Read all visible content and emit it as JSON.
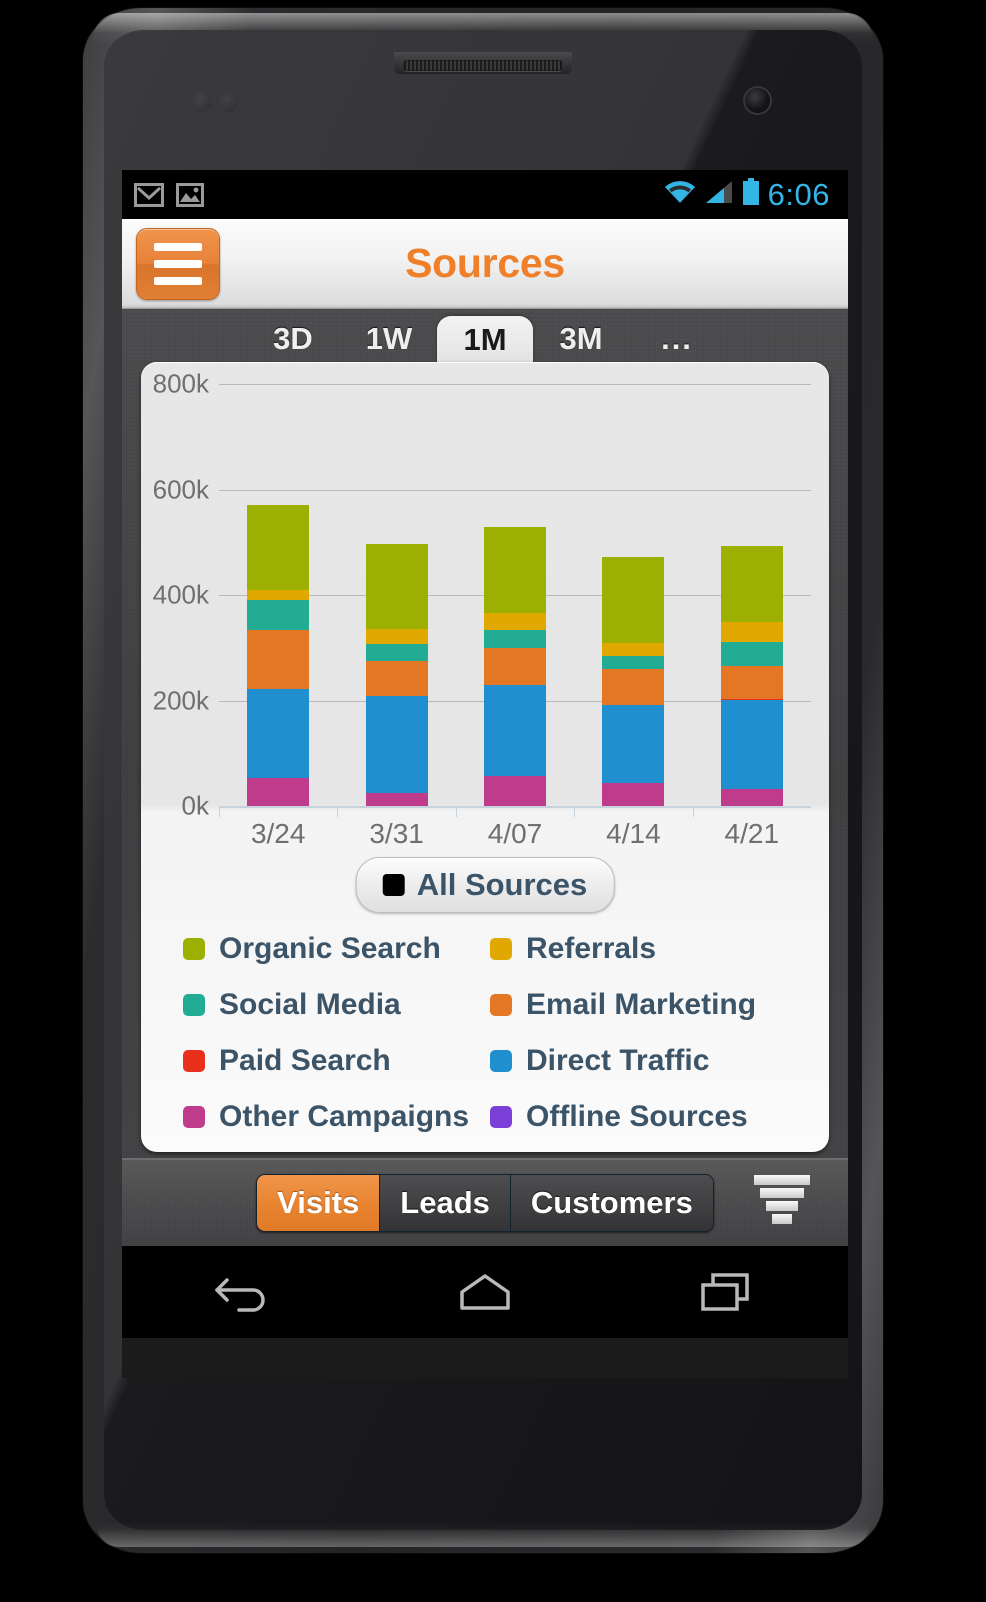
{
  "status_bar": {
    "icons": [
      "gmail-icon",
      "photo-icon"
    ],
    "wifi": "wifi-icon",
    "signal": "signal-icon",
    "battery": "battery-icon",
    "time": "6:06",
    "time_color": "#33b5e5"
  },
  "action_bar": {
    "title": "Sources",
    "title_color": "#ef7f28",
    "menu_icon": "hamburger-menu-icon"
  },
  "range_tabs": {
    "items": [
      {
        "label": "3D",
        "selected": false
      },
      {
        "label": "1W",
        "selected": false
      },
      {
        "label": "1M",
        "selected": true
      },
      {
        "label": "3M",
        "selected": false
      },
      {
        "label": "...",
        "selected": false
      }
    ]
  },
  "filter_button": {
    "label": "All Sources",
    "swatch": "#000000"
  },
  "legend": {
    "items": [
      {
        "label": "Organic Search",
        "color": "#9bb000"
      },
      {
        "label": "Referrals",
        "color": "#e0a800"
      },
      {
        "label": "Social Media",
        "color": "#23ac94"
      },
      {
        "label": "Email Marketing",
        "color": "#e47724"
      },
      {
        "label": "Paid Search",
        "color": "#e8301d"
      },
      {
        "label": "Direct Traffic",
        "color": "#1f8fd0"
      },
      {
        "label": "Other Campaigns",
        "color": "#bf3c8c"
      },
      {
        "label": "Offline Sources",
        "color": "#7b3ed6"
      }
    ]
  },
  "bottom_bar": {
    "segments": [
      {
        "label": "Visits",
        "active": true
      },
      {
        "label": "Leads",
        "active": false
      },
      {
        "label": "Customers",
        "active": false
      }
    ],
    "funnel_icon": "funnel-icon"
  },
  "nav_bar": {
    "back": "back-icon",
    "home": "home-icon",
    "recents": "recents-icon"
  },
  "chart_data": {
    "type": "bar",
    "stacked": true,
    "title": "Sources",
    "xlabel": "",
    "ylabel": "",
    "ylim": [
      0,
      800000
    ],
    "ytick_labels": [
      "0k",
      "200k",
      "400k",
      "600k",
      "800k"
    ],
    "ytick_values": [
      0,
      200000,
      400000,
      600000,
      800000
    ],
    "grid": true,
    "legend_position": "below",
    "categories": [
      "3/24",
      "3/31",
      "4/07",
      "4/14",
      "4/21"
    ],
    "series": [
      {
        "name": "Other Campaigns",
        "color": "#bf3c8c",
        "values": [
          53000,
          25000,
          56000,
          43000,
          32000
        ]
      },
      {
        "name": "Direct Traffic",
        "color": "#1f8fd0",
        "values": [
          169000,
          183000,
          173000,
          148000,
          169000
        ]
      },
      {
        "name": "Paid Search",
        "color": "#e8301d",
        "values": [
          0,
          0,
          0,
          0,
          2000
        ]
      },
      {
        "name": "Email Marketing",
        "color": "#e47724",
        "values": [
          111000,
          66000,
          71000,
          68000,
          62000
        ]
      },
      {
        "name": "Social Media",
        "color": "#23ac94",
        "values": [
          58000,
          34000,
          34000,
          26000,
          45000
        ]
      },
      {
        "name": "Referrals",
        "color": "#e0a800",
        "values": [
          19000,
          28000,
          32000,
          24000,
          39000
        ]
      },
      {
        "name": "Organic Search",
        "color": "#9bb000",
        "values": [
          160000,
          161000,
          163000,
          163000,
          143000
        ]
      }
    ],
    "totals": [
      570000,
      497000,
      529000,
      472000,
      492000
    ]
  }
}
